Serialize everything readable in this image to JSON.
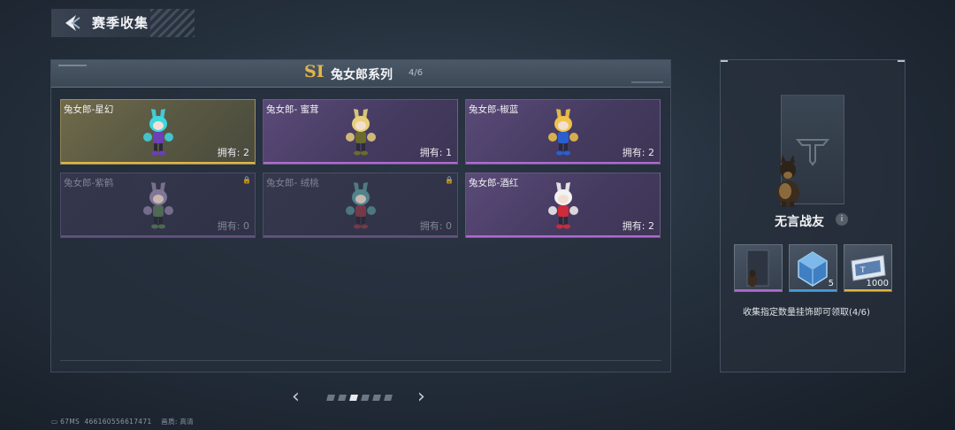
{
  "header": {
    "back_icon": "back-arrow-icon",
    "title": "赛季收集"
  },
  "series": {
    "badge": "SI",
    "name": "兔女郎系列",
    "progress": "4/6"
  },
  "items": [
    {
      "name": "兔女郎-星幻",
      "owned": "拥有: 2",
      "rarity": "gold",
      "locked": false,
      "hair": "#3fd6e0",
      "body": "#6d3fb8"
    },
    {
      "name": "兔女郎- 蜜茸",
      "owned": "拥有: 1",
      "rarity": "purple",
      "locked": false,
      "hair": "#e8cf7a",
      "body": "#6b6b2e"
    },
    {
      "name": "兔女郎-椒蓝",
      "owned": "拥有: 2",
      "rarity": "purple",
      "locked": false,
      "hair": "#f0c44a",
      "body": "#2a5fd0"
    },
    {
      "name": "兔女郎-紫鹤",
      "owned": "拥有: 0",
      "rarity": "purple",
      "locked": true,
      "hair": "#9b8ab0",
      "body": "#5b7a5b"
    },
    {
      "name": "兔女郎- 绒桃",
      "owned": "拥有: 0",
      "rarity": "purple",
      "locked": true,
      "hair": "#5e9aa0",
      "body": "#8a3d4a"
    },
    {
      "name": "兔女郎-酒红",
      "owned": "拥有: 2",
      "rarity": "purple",
      "locked": false,
      "hair": "#f2f2f2",
      "body": "#d02a3a"
    }
  ],
  "pager": {
    "prev_icon": "chevron-left-icon",
    "next_icon": "chevron-right-icon",
    "pages": 6,
    "current": 3
  },
  "footer": {
    "ping": "67MS",
    "uid": "466160556617471",
    "quality": "画质: 高清"
  },
  "reward_panel": {
    "name": "无言战友",
    "info_label": "i",
    "rewards": [
      {
        "icon": "dog-pendant-icon",
        "qty": "",
        "accent": "#b06ad0"
      },
      {
        "icon": "crystal-crate-icon",
        "qty": "5",
        "accent": "#4a9bd8"
      },
      {
        "icon": "ticket-icon",
        "qty": "1000",
        "accent": "#e0b548"
      }
    ],
    "description": "收集指定数量挂饰即可领取(4/6)"
  },
  "colors": {
    "gold": "#e0b548",
    "purple": "#b06ad0",
    "blue": "#4a9bd8"
  }
}
